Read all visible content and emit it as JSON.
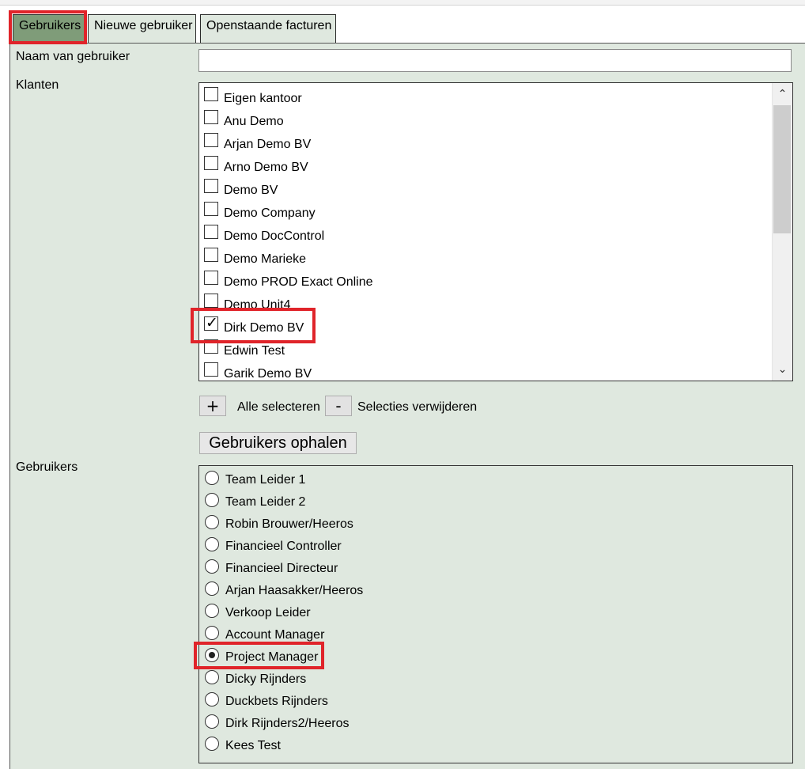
{
  "tabs": [
    {
      "label": "Gebruikers",
      "active": true
    },
    {
      "label": "Nieuwe gebruiker",
      "active": false
    },
    {
      "label": "Openstaande facturen",
      "active": false
    }
  ],
  "form": {
    "username_label": "Naam van gebruiker",
    "username_value": "",
    "clients_label": "Klanten",
    "users_label": "Gebruikers"
  },
  "clients": [
    {
      "label": "Eigen kantoor",
      "checked": false
    },
    {
      "label": "Anu Demo",
      "checked": false
    },
    {
      "label": "Arjan Demo BV",
      "checked": false
    },
    {
      "label": "Arno Demo BV",
      "checked": false
    },
    {
      "label": "Demo BV",
      "checked": false
    },
    {
      "label": "Demo Company",
      "checked": false
    },
    {
      "label": "Demo DocControl",
      "checked": false
    },
    {
      "label": "Demo Marieke",
      "checked": false
    },
    {
      "label": "Demo PROD Exact Online",
      "checked": false
    },
    {
      "label": "Demo Unit4",
      "checked": false
    },
    {
      "label": "Dirk Demo BV",
      "checked": true
    },
    {
      "label": "Edwin Test",
      "checked": false
    },
    {
      "label": "Garik Demo BV",
      "checked": false
    }
  ],
  "selection_controls": {
    "select_all_symbol": "+",
    "select_all_label": "Alle selecteren",
    "clear_symbol": "-",
    "clear_label": "Selecties verwijderen"
  },
  "fetch_button_label": "Gebruikers ophalen",
  "users": [
    {
      "label": "Team Leider 1",
      "selected": false
    },
    {
      "label": "Team Leider 2",
      "selected": false
    },
    {
      "label": "Robin Brouwer/Heeros",
      "selected": false
    },
    {
      "label": "Financieel Controller",
      "selected": false
    },
    {
      "label": "Financieel Directeur",
      "selected": false
    },
    {
      "label": "Arjan Haasakker/Heeros",
      "selected": false
    },
    {
      "label": "Verkoop Leider",
      "selected": false
    },
    {
      "label": "Account Manager",
      "selected": false
    },
    {
      "label": "Project Manager",
      "selected": true
    },
    {
      "label": "Dicky Rijnders",
      "selected": false
    },
    {
      "label": "Duckbets Rijnders",
      "selected": false
    },
    {
      "label": "Dirk Rijnders2/Heeros",
      "selected": false
    },
    {
      "label": "Kees Test",
      "selected": false
    }
  ],
  "icons": {
    "scroll_up": "chevron-up-icon",
    "scroll_down": "chevron-down-icon"
  },
  "colors": {
    "panel_bg": "#dfe8df",
    "active_tab": "#7f9c79",
    "highlight": "#e0242a"
  }
}
